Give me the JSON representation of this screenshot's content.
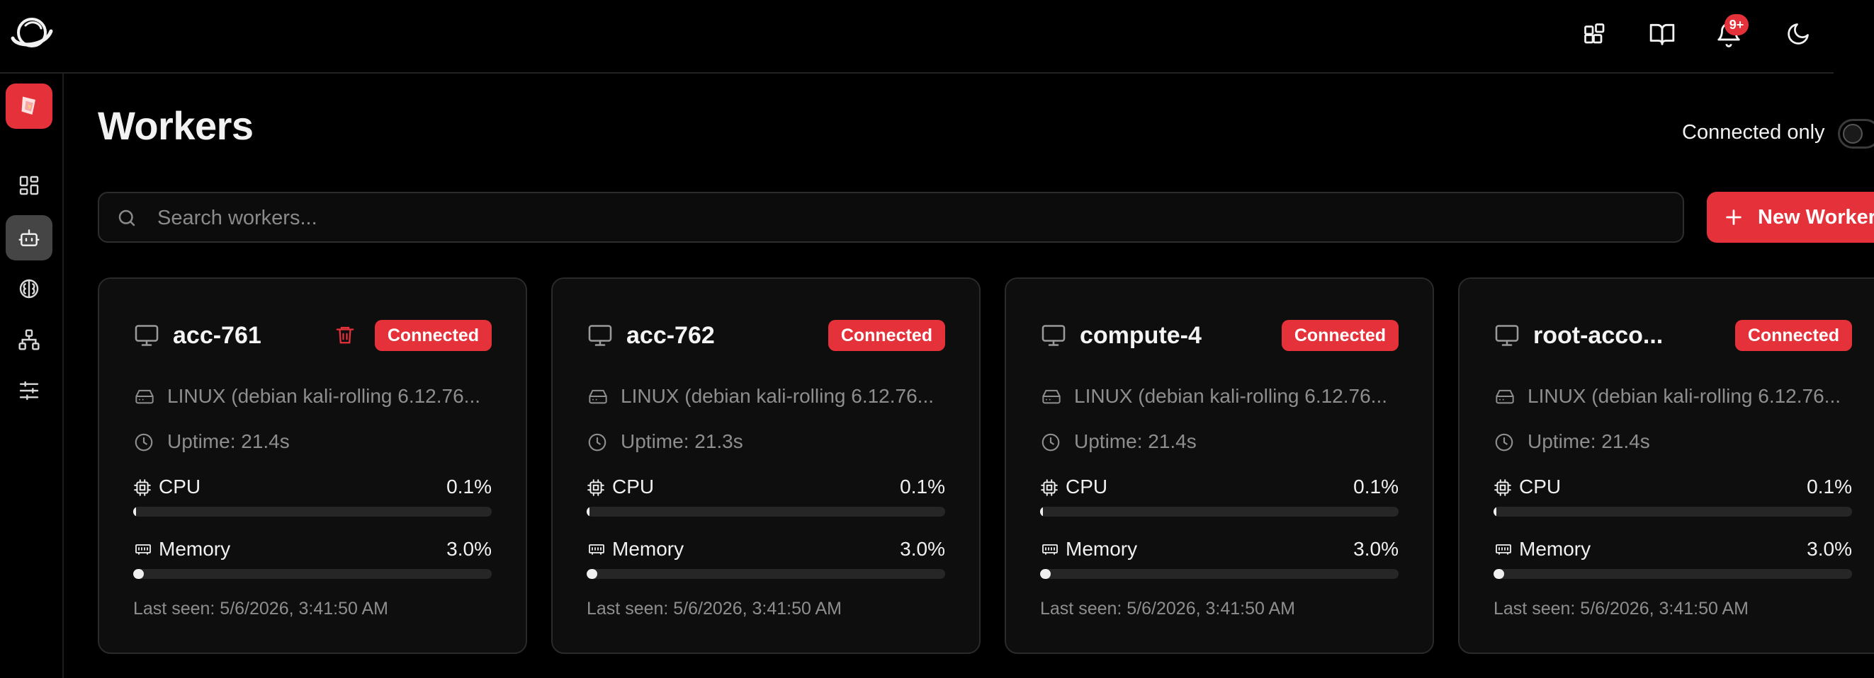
{
  "header": {
    "notifications_badge": "9+"
  },
  "page": {
    "title": "Workers",
    "connected_only_label": "Connected only",
    "connected_only_enabled": false
  },
  "search": {
    "placeholder": "Search workers..."
  },
  "new_worker_label": "New Worker",
  "workers": [
    {
      "name": "acc-761",
      "status": "Connected",
      "os": "LINUX (debian kali-rolling 6.12.76...",
      "uptime": "Uptime: 21.4s",
      "cpu_label": "CPU",
      "cpu_value": "0.1%",
      "cpu_fraction": 0.001,
      "memory_label": "Memory",
      "memory_value": "3.0%",
      "memory_fraction": 0.03,
      "last_seen": "Last seen: 5/6/2026, 3:41:50 AM",
      "deletable": true
    },
    {
      "name": "acc-762",
      "status": "Connected",
      "os": "LINUX (debian kali-rolling 6.12.76...",
      "uptime": "Uptime: 21.3s",
      "cpu_label": "CPU",
      "cpu_value": "0.1%",
      "cpu_fraction": 0.001,
      "memory_label": "Memory",
      "memory_value": "3.0%",
      "memory_fraction": 0.03,
      "last_seen": "Last seen: 5/6/2026, 3:41:50 AM",
      "deletable": false
    },
    {
      "name": "compute-4",
      "status": "Connected",
      "os": "LINUX (debian kali-rolling 6.12.76...",
      "uptime": "Uptime: 21.4s",
      "cpu_label": "CPU",
      "cpu_value": "0.1%",
      "cpu_fraction": 0.001,
      "memory_label": "Memory",
      "memory_value": "3.0%",
      "memory_fraction": 0.03,
      "last_seen": "Last seen: 5/6/2026, 3:41:50 AM",
      "deletable": false
    },
    {
      "name": "root-acco...",
      "status": "Connected",
      "os": "LINUX (debian kali-rolling 6.12.76...",
      "uptime": "Uptime: 21.4s",
      "cpu_label": "CPU",
      "cpu_value": "0.1%",
      "cpu_fraction": 0.001,
      "memory_label": "Memory",
      "memory_value": "3.0%",
      "memory_fraction": 0.03,
      "last_seen": "Last seen: 5/6/2026, 3:41:50 AM",
      "deletable": false
    }
  ],
  "icons": {
    "logo": "planet-logo-icon",
    "header": [
      "blocks-icon",
      "book-open-icon",
      "bell-icon",
      "moon-icon"
    ],
    "sidebar": [
      "app-icon",
      "dashboard-icon",
      "bot-icon",
      "brain-icon",
      "network-icon",
      "sliders-icon"
    ]
  },
  "colors": {
    "accent": "#e5323a",
    "background": "#000000",
    "card": "#0e0e0e"
  }
}
